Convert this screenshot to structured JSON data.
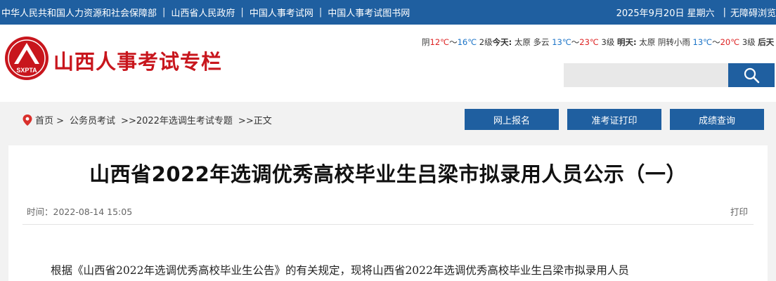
{
  "topbar": {
    "links": [
      "中华人民共和国人力资源和社会保障部",
      "山西省人民政府",
      "中国人事考试网",
      "中国人事考试图书网"
    ],
    "separator": "|",
    "date": "2025年9月20日 星期六",
    "accessibility": "无障碍浏览"
  },
  "header": {
    "logo_text": "SXPTA",
    "site_title": "山西人事考试专栏",
    "weather": {
      "frag1": "阴",
      "frag1_hi": "12℃",
      "frag1_tilde": "～",
      "frag1_lo": "16℃",
      "frag1_wind": "2级",
      "today_label": "今天:",
      "today_city": "太原",
      "today_cond": "多云",
      "today_lo": "13℃",
      "today_tilde": "～",
      "today_hi": "23℃",
      "today_wind": "3级",
      "tomorrow_label": "明天:",
      "tomorrow_city": "太原",
      "tomorrow_cond": "阴转小雨",
      "tomorrow_lo": "13℃",
      "tomorrow_tilde": "～",
      "tomorrow_hi": "20℃",
      "tomorrow_wind": "3级",
      "after_label": "后天"
    },
    "search_placeholder": ""
  },
  "breadcrumb": {
    "home": "首页 >",
    "level1": "公务员考试",
    "level2": ">>2022年选调生考试专题",
    "level3": ">>正文"
  },
  "nav_buttons": {
    "register": "网上报名",
    "admit_card": "准考证打印",
    "score": "成绩查询"
  },
  "article": {
    "title": "山西省2022年选调优秀高校毕业生吕梁市拟录用人员公示（一）",
    "time_label": "时间：",
    "time_value": "2022-08-14 15:05",
    "print_label": "打印",
    "first_line": "根据《山西省2022年选调优秀高校毕业生公告》的有关规定，现将山西省2022年选调优秀高校毕业生吕梁市拟录用人员"
  },
  "colors": {
    "primary_blue": "#1f5fa0",
    "brand_red": "#c8161d"
  }
}
